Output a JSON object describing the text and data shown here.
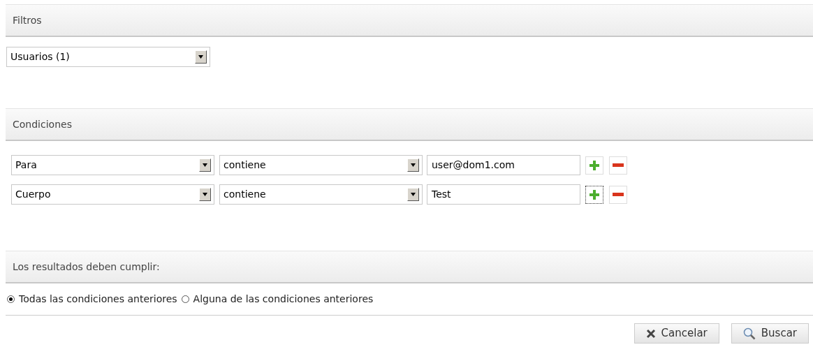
{
  "filters": {
    "title": "Filtros",
    "select": {
      "value": "Usuarios (1)"
    }
  },
  "conditions": {
    "title": "Condiciones",
    "rows": [
      {
        "field": "Para",
        "operator": "contiene",
        "value": "user@dom1.com",
        "add_focused": false
      },
      {
        "field": "Cuerpo",
        "operator": "contiene",
        "value": "Test",
        "add_focused": true
      }
    ]
  },
  "match": {
    "title": "Los resultados deben cumplir:",
    "options": [
      {
        "label": "Todas las condiciones anteriores",
        "selected": true
      },
      {
        "label": "Alguna de las condiciones anteriores",
        "selected": false
      }
    ]
  },
  "buttons": [
    {
      "kind": "cancel",
      "label": "Cancelar"
    },
    {
      "kind": "search",
      "label": "Buscar"
    }
  ]
}
